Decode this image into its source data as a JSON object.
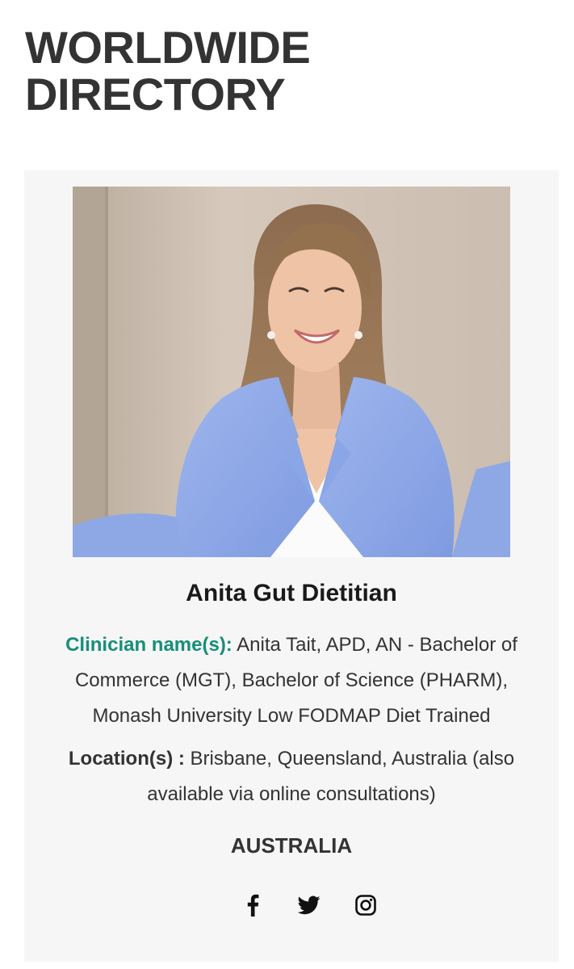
{
  "page": {
    "title_line1": "WORLDWIDE",
    "title_line2": "DIRECTORY"
  },
  "listing": {
    "business_name": "Anita Gut Dietitian",
    "clinician_label": "Clinician name(s):",
    "clinician_value": "Anita Tait, APD, AN - Bachelor of Commerce (MGT), Bachelor of Science (PHARM), Monash University Low FODMAP Diet Trained",
    "location_label": "Location(s) :",
    "location_value": "Brisbane, Queensland, Australia (also available via online consultations)",
    "country": "AUSTRALIA",
    "photo_icon": "portrait-photo"
  },
  "socials": {
    "icons": [
      "facebook-icon",
      "twitter-icon",
      "instagram-icon"
    ]
  },
  "colors": {
    "accent_green": "#168f79",
    "card_background": "#f6f6f6",
    "text_dark": "#333333"
  }
}
